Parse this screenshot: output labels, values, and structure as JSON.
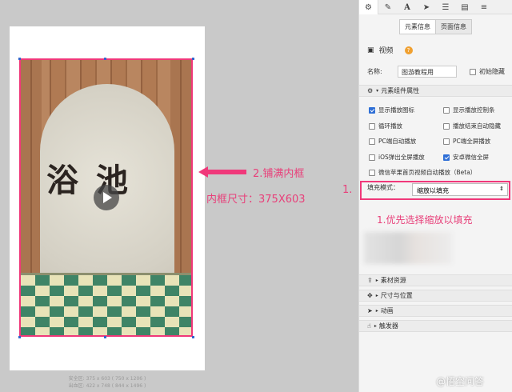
{
  "canvas": {
    "scene_text": "浴池",
    "safe_area_line1": "安全区: 375 x 603 ( 750 x 1206 )",
    "safe_area_line2": "出血区: 422 x 748 ( 844 x 1496 )"
  },
  "annotations": {
    "fill_frame": "2.铺满内框",
    "frame_size": "内框尺寸：375X603",
    "step_marker": "1.",
    "prefer_scale": "1.优先选择缩放以填充"
  },
  "panel": {
    "tabs": [
      "gear-icon",
      "pencil-icon",
      "text-icon",
      "send-icon",
      "list-icon",
      "document-icon",
      "database-icon"
    ],
    "subtabs": {
      "element_info": "元素信息",
      "page_info": "页面信息"
    },
    "element_type": "视频",
    "name_label": "名称:",
    "name_value": "图游教程用",
    "initial_hidden": "初始隐藏",
    "section_props": "元素组件属性",
    "options": [
      {
        "label": "显示播放图标",
        "checked": true
      },
      {
        "label": "显示播放控制条",
        "checked": false
      },
      {
        "label": "循环播放",
        "checked": false
      },
      {
        "label": "播放结束自动隐藏",
        "checked": false
      },
      {
        "label": "PC端自动播放",
        "checked": false
      },
      {
        "label": "PC端全屏播放",
        "checked": false
      },
      {
        "label": "iOS弹出全屏播放",
        "checked": false
      },
      {
        "label": "安卓微信全屏",
        "checked": true
      },
      {
        "label": "微信苹果首页视频自动播放（Beta）",
        "checked": false
      }
    ],
    "fill_mode_label": "填充模式：",
    "fill_mode_value": "缩放以填充",
    "sections": [
      "素材资源",
      "尺寸与位置",
      "动画",
      "触发器"
    ]
  },
  "watermark": "@悟空问答",
  "colors": {
    "accent_pink": "#f0387a",
    "checkbox_blue": "#2f6fd6",
    "help_orange": "#f0a030"
  }
}
